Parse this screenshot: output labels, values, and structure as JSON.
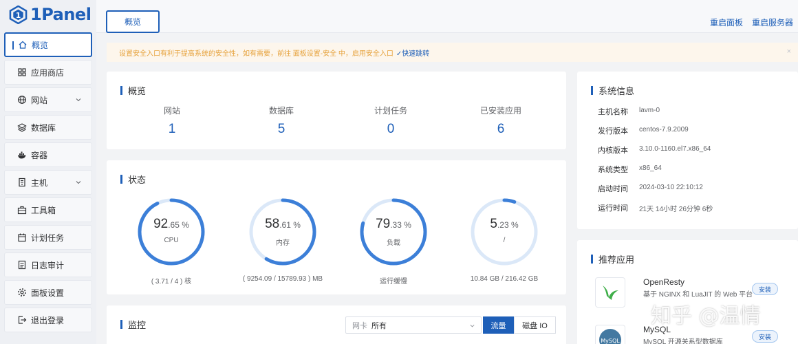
{
  "brand": {
    "name": "1Panel",
    "color": "#1e5fb8"
  },
  "sidebar": {
    "items": [
      {
        "label": "概览",
        "icon": "home-icon",
        "active": true
      },
      {
        "label": "应用商店",
        "icon": "grid-icon"
      },
      {
        "label": "网站",
        "icon": "globe-icon",
        "has_submenu": true
      },
      {
        "label": "数据库",
        "icon": "layers-icon"
      },
      {
        "label": "容器",
        "icon": "docker-icon"
      },
      {
        "label": "主机",
        "icon": "server-icon",
        "has_submenu": true
      },
      {
        "label": "工具箱",
        "icon": "toolbox-icon"
      },
      {
        "label": "计划任务",
        "icon": "calendar-icon"
      },
      {
        "label": "日志审计",
        "icon": "log-icon"
      },
      {
        "label": "面板设置",
        "icon": "gear-icon"
      },
      {
        "label": "退出登录",
        "icon": "logout-icon"
      }
    ]
  },
  "header": {
    "tab": "概览",
    "restart_panel": "重启面板",
    "restart_server": "重启服务器"
  },
  "alert": {
    "text": "设置安全入口有利于提高系统的安全性，如有需要，前往 面板设置-安全 中，启用安全入口",
    "link": "快速跳转",
    "close": "×"
  },
  "overview": {
    "title": "概览",
    "stats": [
      {
        "label": "网站",
        "value": "1"
      },
      {
        "label": "数据库",
        "value": "5"
      },
      {
        "label": "计划任务",
        "value": "0"
      },
      {
        "label": "已安装应用",
        "value": "6"
      }
    ]
  },
  "status": {
    "title": "状态",
    "gauges": [
      {
        "int": "92",
        "dec": ".65",
        "unit": "%",
        "label": "CPU",
        "footer": "( 3.71 / 4 ) 核",
        "percent": 92.65
      },
      {
        "int": "58",
        "dec": ".61",
        "unit": "%",
        "label": "内存",
        "footer": "( 9254.09 / 15789.93 ) MB",
        "percent": 58.61
      },
      {
        "int": "79",
        "dec": ".33",
        "unit": "%",
        "label": "负载",
        "footer": "运行缓慢",
        "percent": 79.33
      },
      {
        "int": "5",
        "dec": ".23",
        "unit": "%",
        "label": "/",
        "footer": "10.84 GB / 216.42 GB",
        "percent": 5.23
      }
    ]
  },
  "monitor": {
    "title": "监控",
    "nic_label": "网卡",
    "nic_value": "所有",
    "tab_traffic": "流量",
    "tab_disk": "磁盘 IO"
  },
  "system_info": {
    "title": "系统信息",
    "rows": [
      {
        "k": "主机名称",
        "v": "lavm-0"
      },
      {
        "k": "发行版本",
        "v": "centos-7.9.2009"
      },
      {
        "k": "内核版本",
        "v": "3.10.0-1160.el7.x86_64"
      },
      {
        "k": "系统类型",
        "v": "x86_64"
      },
      {
        "k": "启动时间",
        "v": "2024-03-10 22:10:12"
      },
      {
        "k": "运行时间",
        "v": "21天 14小时 26分钟 6秒"
      }
    ]
  },
  "recommended": {
    "title": "推荐应用",
    "apps": [
      {
        "name": "OpenResty",
        "desc": "基于 NGINX 和 LuaJIT 的 Web 平台",
        "button": "安装"
      },
      {
        "name": "MySQL",
        "desc": "MySQL 开源关系型数据库",
        "button": "安装"
      }
    ]
  },
  "watermark": "知乎 @温情"
}
